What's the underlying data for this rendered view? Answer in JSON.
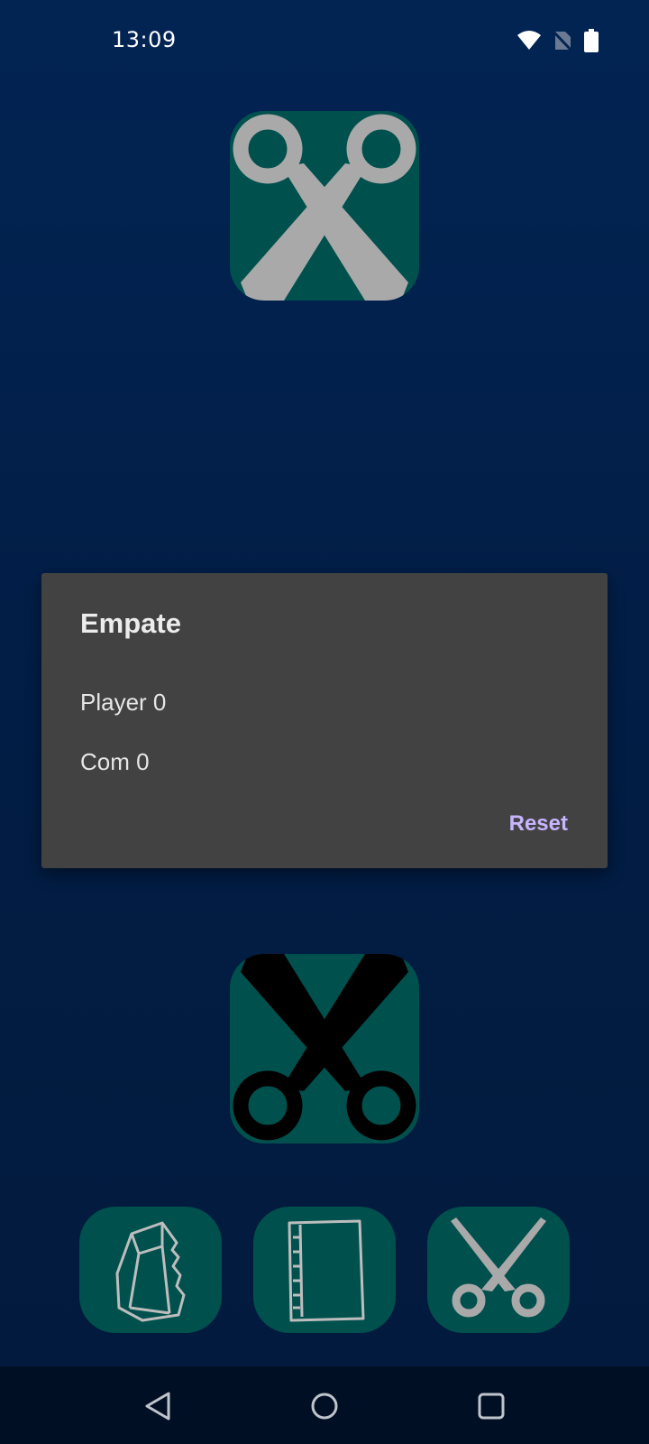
{
  "status_bar": {
    "time": "13:09",
    "icons": [
      "wifi-icon",
      "no-sim-icon",
      "battery-icon"
    ]
  },
  "game": {
    "computer_choice": "scissors",
    "player_choice": "scissors",
    "buttons": [
      {
        "name": "rock",
        "icon": "rock-icon"
      },
      {
        "name": "paper",
        "icon": "paper-icon"
      },
      {
        "name": "scissors",
        "icon": "scissors-icon"
      }
    ]
  },
  "dialog": {
    "title": "Empate",
    "player_line": "Player 0",
    "com_line": "Com 0",
    "reset_label": "Reset"
  },
  "nav_bar": {
    "icons": [
      "back-icon",
      "home-icon",
      "recents-icon"
    ]
  },
  "colors": {
    "background": "#022453",
    "tile": "#00504d",
    "dialog": "#424242",
    "accent": "#c8b4ff"
  }
}
